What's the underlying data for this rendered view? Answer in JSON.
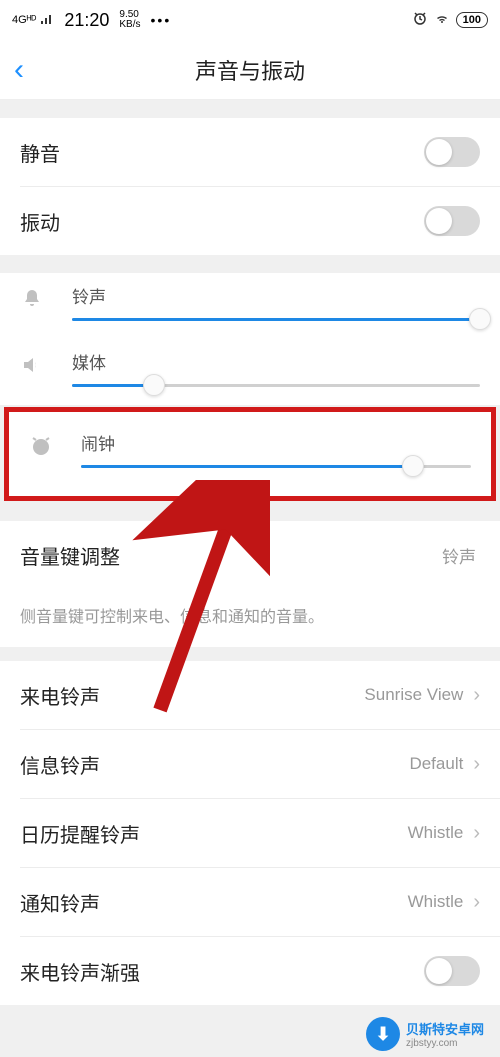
{
  "status": {
    "network": "4Gᴴᴰ",
    "signal": "📶",
    "time": "21:20",
    "kb_rate": "9.50",
    "kb_unit": "KB/s",
    "alarm_icon": "⏰",
    "wifi_icon": "📶",
    "battery": "100"
  },
  "nav": {
    "back": "‹",
    "title": "声音与振动"
  },
  "toggles": {
    "mute_label": "静音",
    "vibrate_label": "振动"
  },
  "sliders": {
    "ringtone": {
      "label": "铃声",
      "value": 100
    },
    "media": {
      "label": "媒体",
      "value": 20
    },
    "alarm": {
      "label": "闹钟",
      "value": 85
    }
  },
  "volkey": {
    "label": "音量键调整",
    "value": "铃声",
    "desc": "侧音量键可控制来电、信息和通知的音量。"
  },
  "ringtones": {
    "incoming": {
      "label": "来电铃声",
      "value": "Sunrise View"
    },
    "message": {
      "label": "信息铃声",
      "value": "Default"
    },
    "calendar": {
      "label": "日历提醒铃声",
      "value": "Whistle"
    },
    "notification": {
      "label": "通知铃声",
      "value": "Whistle"
    },
    "crescendo": {
      "label": "来电铃声渐强"
    }
  },
  "watermark": {
    "brand": "贝斯特安卓网",
    "url": "zjbstyy.com",
    "icon": "⬇"
  }
}
